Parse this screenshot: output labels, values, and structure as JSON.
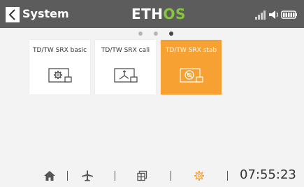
{
  "header": {
    "title": "System",
    "logo_part1": "ETH",
    "logo_part2": "OS"
  },
  "pager": {
    "pages": 3,
    "active_index": 2
  },
  "tiles": [
    {
      "label": "TD/TW SRX basic",
      "icon": "gear-icon",
      "selected": false
    },
    {
      "label": "TD/TW SRX cali",
      "icon": "calibration-icon",
      "selected": false
    },
    {
      "label": "TD/TW SRX stab",
      "icon": "stabilizer-icon",
      "selected": true
    }
  ],
  "bottom_bar": {
    "items": [
      "home-icon",
      "airplane-icon",
      "model-grid-icon",
      "system-gear-icon"
    ],
    "active_item": "system-gear-icon",
    "clock": "07:55:23"
  },
  "colors": {
    "header_bg": "#5c5c5c",
    "accent": "#f7a133",
    "logo_green": "#86c540",
    "page_bg": "#f3f3f3"
  }
}
